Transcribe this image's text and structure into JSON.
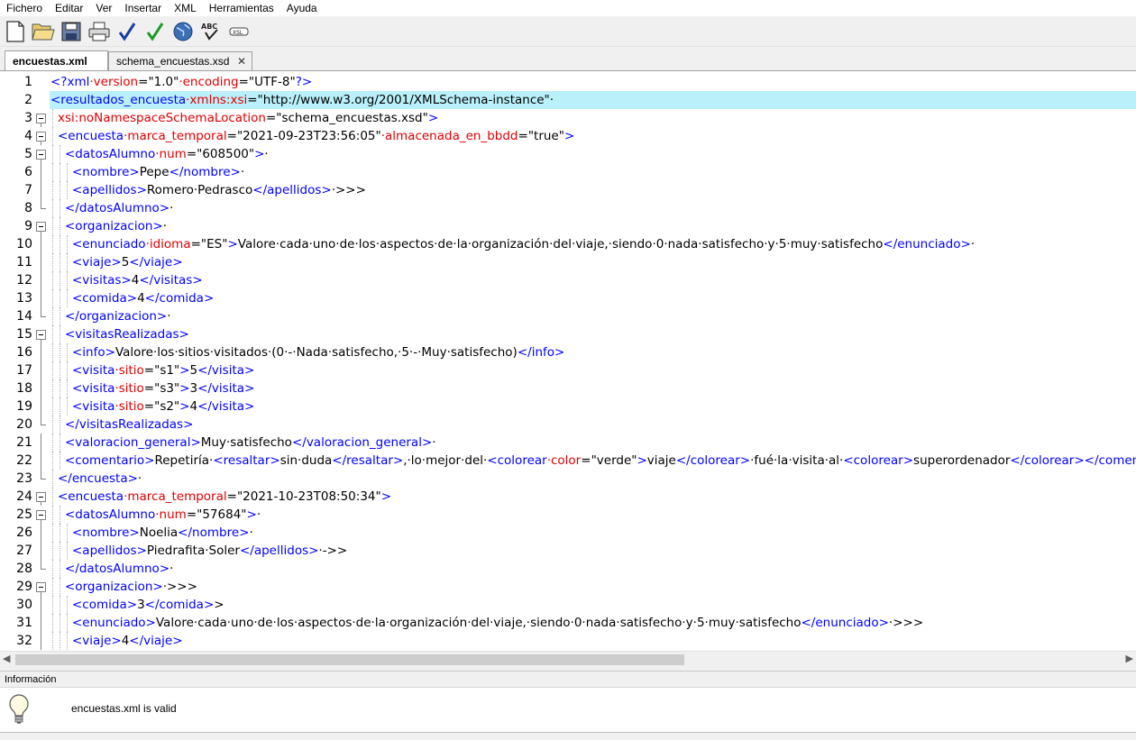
{
  "menu": [
    "Fichero",
    "Editar",
    "Ver",
    "Insertar",
    "XML",
    "Herramientas",
    "Ayuda"
  ],
  "toolbar": {
    "new": "new-file-icon",
    "open": "open-folder-icon",
    "save": "save-icon",
    "print": "print-icon",
    "check": "check-well-formed-icon",
    "validate": "validate-icon",
    "browser": "globe-icon",
    "spell": "spellcheck-icon",
    "xsl": "xsl-icon"
  },
  "tabs": [
    {
      "label": "encuestas.xml",
      "active": true
    },
    {
      "label": "schema_encuestas.xsd",
      "active": false
    }
  ],
  "editor": {
    "lines": [
      {
        "n": "1",
        "fold": "none",
        "ind": 0,
        "segs": [
          [
            "t",
            "<?"
          ],
          [
            "t",
            "xml"
          ],
          [
            "a",
            "·version"
          ],
          [
            "x",
            "="
          ],
          [
            "v",
            "\"1.0\""
          ],
          [
            "a",
            "·encoding"
          ],
          [
            "x",
            "="
          ],
          [
            "v",
            "\"UTF-8\""
          ],
          [
            "t",
            "?>"
          ]
        ]
      },
      {
        "n": "2",
        "fold": "none",
        "ind": 0,
        "segs": [
          [
            "t",
            "<resultados_encuesta"
          ],
          [
            "a",
            "·xmlns:xsi"
          ],
          [
            "x",
            "="
          ],
          [
            "v",
            "\"http://www.w3.org/2001/XMLSchema-instance\""
          ],
          [
            "x",
            "·"
          ]
        ]
      },
      {
        "n": "3",
        "fold": "open",
        "ind": 1,
        "segs": [
          [
            "a",
            "xsi:noNamespaceSchemaLocation"
          ],
          [
            "x",
            "="
          ],
          [
            "v",
            "\"schema_encuestas.xsd\""
          ],
          [
            "t",
            ">"
          ]
        ]
      },
      {
        "n": "4",
        "fold": "open",
        "ind": 1,
        "segs": [
          [
            "t",
            "<encuesta"
          ],
          [
            "a",
            "·marca_temporal"
          ],
          [
            "x",
            "="
          ],
          [
            "v",
            "\"2021-09-23T23:56:05\""
          ],
          [
            "a",
            "·almacenada_en_bbdd"
          ],
          [
            "x",
            "="
          ],
          [
            "v",
            "\"true\""
          ],
          [
            "t",
            ">"
          ]
        ]
      },
      {
        "n": "5",
        "fold": "open",
        "ind": 2,
        "segs": [
          [
            "t",
            "<datosAlumno"
          ],
          [
            "a",
            "·num"
          ],
          [
            "x",
            "="
          ],
          [
            "v",
            "\"608500\""
          ],
          [
            "t",
            ">"
          ],
          [
            "x",
            "·"
          ]
        ]
      },
      {
        "n": "6",
        "fold": "line",
        "ind": 3,
        "segs": [
          [
            "t",
            "<nombre>"
          ],
          [
            "x",
            "Pepe"
          ],
          [
            "t",
            "</nombre>"
          ],
          [
            "x",
            "·"
          ]
        ]
      },
      {
        "n": "7",
        "fold": "line",
        "ind": 3,
        "segs": [
          [
            "t",
            "<apellidos>"
          ],
          [
            "x",
            "Romero·Pedrasco"
          ],
          [
            "t",
            "</apellidos>"
          ],
          [
            "x",
            "·>>>"
          ]
        ]
      },
      {
        "n": "8",
        "fold": "end",
        "ind": 2,
        "segs": [
          [
            "t",
            "</datosAlumno>"
          ],
          [
            "x",
            "·"
          ]
        ]
      },
      {
        "n": "9",
        "fold": "open",
        "ind": 2,
        "segs": [
          [
            "t",
            "<organizacion>"
          ],
          [
            "x",
            "·"
          ]
        ]
      },
      {
        "n": "10",
        "fold": "line",
        "ind": 3,
        "segs": [
          [
            "t",
            "<enunciado"
          ],
          [
            "a",
            "·idioma"
          ],
          [
            "x",
            "="
          ],
          [
            "v",
            "\"ES\""
          ],
          [
            "t",
            ">"
          ],
          [
            "x",
            "Valore·cada·uno·de·los·aspectos·de·la·organización·del·viaje,·siendo·0·nada·satisfecho·y·5·muy·satisfecho"
          ],
          [
            "t",
            "</enunciado>"
          ],
          [
            "x",
            "·"
          ]
        ]
      },
      {
        "n": "11",
        "fold": "line",
        "ind": 3,
        "segs": [
          [
            "t",
            "<viaje>"
          ],
          [
            "x",
            "5"
          ],
          [
            "t",
            "</viaje>"
          ]
        ]
      },
      {
        "n": "12",
        "fold": "line",
        "ind": 3,
        "segs": [
          [
            "t",
            "<visitas>"
          ],
          [
            "x",
            "4"
          ],
          [
            "t",
            "</visitas>"
          ]
        ]
      },
      {
        "n": "13",
        "fold": "line",
        "ind": 3,
        "segs": [
          [
            "t",
            "<comida>"
          ],
          [
            "x",
            "4"
          ],
          [
            "t",
            "</comida>"
          ]
        ]
      },
      {
        "n": "14",
        "fold": "end",
        "ind": 2,
        "segs": [
          [
            "t",
            "</organizacion>"
          ],
          [
            "x",
            "·"
          ]
        ]
      },
      {
        "n": "15",
        "fold": "open",
        "ind": 2,
        "segs": [
          [
            "t",
            "<visitasRealizadas>"
          ]
        ]
      },
      {
        "n": "16",
        "fold": "line",
        "ind": 3,
        "segs": [
          [
            "t",
            "<info>"
          ],
          [
            "x",
            "Valore·los·sitios·visitados·(0·-·Nada·satisfecho,·5·-·Muy·satisfecho)"
          ],
          [
            "t",
            "</info>"
          ]
        ]
      },
      {
        "n": "17",
        "fold": "line",
        "ind": 3,
        "segs": [
          [
            "t",
            "<visita"
          ],
          [
            "a",
            "·sitio"
          ],
          [
            "x",
            "="
          ],
          [
            "v",
            "\"s1\""
          ],
          [
            "t",
            ">"
          ],
          [
            "x",
            "5"
          ],
          [
            "t",
            "</visita>"
          ]
        ]
      },
      {
        "n": "18",
        "fold": "line",
        "ind": 3,
        "segs": [
          [
            "t",
            "<visita"
          ],
          [
            "a",
            "·sitio"
          ],
          [
            "x",
            "="
          ],
          [
            "v",
            "\"s3\""
          ],
          [
            "t",
            ">"
          ],
          [
            "x",
            "3"
          ],
          [
            "t",
            "</visita>"
          ]
        ]
      },
      {
        "n": "19",
        "fold": "line",
        "ind": 3,
        "segs": [
          [
            "t",
            "<visita"
          ],
          [
            "a",
            "·sitio"
          ],
          [
            "x",
            "="
          ],
          [
            "v",
            "\"s2\""
          ],
          [
            "t",
            ">"
          ],
          [
            "x",
            "4"
          ],
          [
            "t",
            "</visita>"
          ]
        ]
      },
      {
        "n": "20",
        "fold": "end",
        "ind": 2,
        "segs": [
          [
            "t",
            "</visitasRealizadas>"
          ]
        ]
      },
      {
        "n": "21",
        "fold": "line",
        "ind": 2,
        "segs": [
          [
            "t",
            "<valoracion_general>"
          ],
          [
            "x",
            "Muy·satisfecho"
          ],
          [
            "t",
            "</valoracion_general>"
          ],
          [
            "x",
            "·"
          ]
        ]
      },
      {
        "n": "22",
        "fold": "line",
        "ind": 2,
        "segs": [
          [
            "t",
            "<comentario>"
          ],
          [
            "x",
            "Repetiría·"
          ],
          [
            "t",
            "<resaltar>"
          ],
          [
            "x",
            "sin·duda"
          ],
          [
            "t",
            "</resaltar>"
          ],
          [
            "x",
            ",·lo·mejor·del·"
          ],
          [
            "t",
            "<colorear"
          ],
          [
            "a",
            "·color"
          ],
          [
            "x",
            "="
          ],
          [
            "v",
            "\"verde\""
          ],
          [
            "t",
            ">"
          ],
          [
            "x",
            "viaje"
          ],
          [
            "t",
            "</colorear>"
          ],
          [
            "x",
            "·fué·la·visita·al·"
          ],
          [
            "t",
            "<colorear>"
          ],
          [
            "x",
            "superordenador"
          ],
          [
            "t",
            "</colorear></comentario>"
          ]
        ]
      },
      {
        "n": "23",
        "fold": "end",
        "ind": 1,
        "segs": [
          [
            "t",
            "</encuesta>"
          ],
          [
            "x",
            "·"
          ]
        ]
      },
      {
        "n": "24",
        "fold": "open",
        "ind": 1,
        "segs": [
          [
            "t",
            "<encuesta"
          ],
          [
            "a",
            "·marca_temporal"
          ],
          [
            "x",
            "="
          ],
          [
            "v",
            "\"2021-10-23T08:50:34\""
          ],
          [
            "t",
            ">"
          ]
        ]
      },
      {
        "n": "25",
        "fold": "open",
        "ind": 2,
        "segs": [
          [
            "t",
            "<datosAlumno"
          ],
          [
            "a",
            "·num"
          ],
          [
            "x",
            "="
          ],
          [
            "v",
            "\"57684\""
          ],
          [
            "t",
            ">"
          ],
          [
            "x",
            "·"
          ]
        ]
      },
      {
        "n": "26",
        "fold": "line",
        "ind": 3,
        "segs": [
          [
            "t",
            "<nombre>"
          ],
          [
            "x",
            "Noelia"
          ],
          [
            "t",
            "</nombre>"
          ],
          [
            "x",
            "·"
          ]
        ]
      },
      {
        "n": "27",
        "fold": "line",
        "ind": 3,
        "segs": [
          [
            "t",
            "<apellidos>"
          ],
          [
            "x",
            "Piedrafita·Soler"
          ],
          [
            "t",
            "</apellidos>"
          ],
          [
            "x",
            "·->>"
          ]
        ]
      },
      {
        "n": "28",
        "fold": "end",
        "ind": 2,
        "segs": [
          [
            "t",
            "</datosAlumno>"
          ],
          [
            "x",
            "·"
          ]
        ]
      },
      {
        "n": "29",
        "fold": "open",
        "ind": 2,
        "segs": [
          [
            "t",
            "<organizacion>"
          ],
          [
            "x",
            "·>>>"
          ]
        ]
      },
      {
        "n": "30",
        "fold": "line",
        "ind": 3,
        "segs": [
          [
            "t",
            "<comida>"
          ],
          [
            "x",
            "3"
          ],
          [
            "t",
            "</comida>"
          ],
          [
            "x",
            ">"
          ]
        ]
      },
      {
        "n": "31",
        "fold": "line",
        "ind": 3,
        "segs": [
          [
            "t",
            "<enunciado>"
          ],
          [
            "x",
            "Valore·cada·uno·de·los·aspectos·de·la·organización·del·viaje,·siendo·0·nada·satisfecho·y·5·muy·satisfecho"
          ],
          [
            "t",
            "</enunciado>"
          ],
          [
            "x",
            "·>>>"
          ]
        ]
      },
      {
        "n": "32",
        "fold": "line",
        "ind": 3,
        "segs": [
          [
            "t",
            "<viaje>"
          ],
          [
            "x",
            "4"
          ],
          [
            "t",
            "</viaje>"
          ]
        ]
      }
    ]
  },
  "info": {
    "title": "Información",
    "message": "encuestas.xml is valid",
    "icon": "lightbulb-icon"
  }
}
